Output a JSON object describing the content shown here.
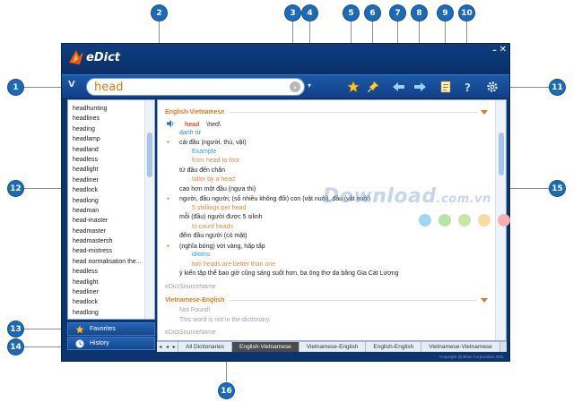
{
  "app": {
    "title": "eDict",
    "minimize_label": "–",
    "close_label": "✕"
  },
  "search": {
    "value": "head",
    "toggle": "V",
    "go": "›",
    "dropdown": "▾"
  },
  "toolbar": {
    "favorite_icon": "star-icon",
    "pin_icon": "pin-icon",
    "back_icon": "back-arrow-icon",
    "forward_icon": "forward-arrow-icon",
    "note_icon": "notepad-icon",
    "help_icon": "help-icon",
    "settings_icon": "gear-icon"
  },
  "word_list": [
    "headhunting",
    "headlines",
    "heading",
    "headlamp",
    "headland",
    "headless",
    "headlight",
    "headliner",
    "headlock",
    "headlong",
    "headman",
    "head-master",
    "headmaster",
    "headmastersh",
    "head-mistress",
    "head normalisation the...",
    "headless",
    "headlight",
    "headliner",
    "headlock",
    "headlong"
  ],
  "left_buttons": {
    "favorites": "Favorites",
    "history": "History"
  },
  "content": {
    "section1": "English-Vietnamese",
    "headword": "head",
    "phonetic": "\\hed\\",
    "pos": "danh từ",
    "lines": [
      {
        "bullet": true,
        "text": "cái đầu (người, thú, vật)"
      },
      {
        "cls": "i2 cy",
        "text": "Example"
      },
      {
        "cls": "i2 or",
        "text": "from head to foot"
      },
      {
        "cls": "i1",
        "text": "từ đầu đến chân"
      },
      {
        "cls": "i2 or",
        "text": "taller by a head"
      },
      {
        "cls": "i1",
        "text": "cao hơn một đầu (ngựa thi)"
      },
      {
        "bullet": true,
        "text": "người, đầu người; (số nhiều không đổi) con (vật nuôi), đầu (vật nuôi)"
      },
      {
        "cls": "i2 or",
        "text": "5 shillings per head"
      },
      {
        "cls": "i1",
        "text": "mỗi (đầu) người được 5 silinh"
      },
      {
        "cls": "i2 or",
        "text": "to count heads"
      },
      {
        "cls": "i1",
        "text": "đếm đầu người (có mặt)"
      },
      {
        "bullet": true,
        "text": "(nghĩa bóng) với vàng, hấp tấp"
      },
      {
        "cls": "i2 cy",
        "text": "idioms"
      },
      {
        "cls": "i2 or",
        "text": "two heads are better than one"
      },
      {
        "cls": "i1",
        "text": "ý kiến tập thể bao giờ cũng sáng suốt hơn, ba ông thợ da bằng Gia Cát Lượng"
      }
    ],
    "source1": "eDictSourceName",
    "section2": "Vietnamese-English",
    "not_found": "Not Found!",
    "not_found_msg": "This word is not in the dictionary.",
    "source2": "eDictSourceName"
  },
  "tabs": [
    "All Dictionaries",
    "English-Vietnamese",
    "Vietnamese-English",
    "English-English",
    "Vietnamese-Vietnamese"
  ],
  "active_tab": 1,
  "tab_arrows": {
    "left": "◂",
    "back": "◂",
    "next": "▸"
  },
  "copyright": "Copyright @ Bkav Corporation 2011",
  "watermark": {
    "main": "Download",
    "suffix": ".com.vn"
  },
  "watermark_dots": [
    "#9ed7f2",
    "#b9e3a8",
    "#c7e8a0",
    "#f7dc9d",
    "#f7b0b0"
  ],
  "callouts": [
    "1",
    "2",
    "3",
    "4",
    "5",
    "6",
    "7",
    "8",
    "9",
    "10",
    "11",
    "12",
    "13",
    "14",
    "15",
    "16"
  ],
  "colors": {
    "accent": "#e07a14",
    "brand_blue": "#0b3470",
    "badge": "#1b6bb8"
  }
}
